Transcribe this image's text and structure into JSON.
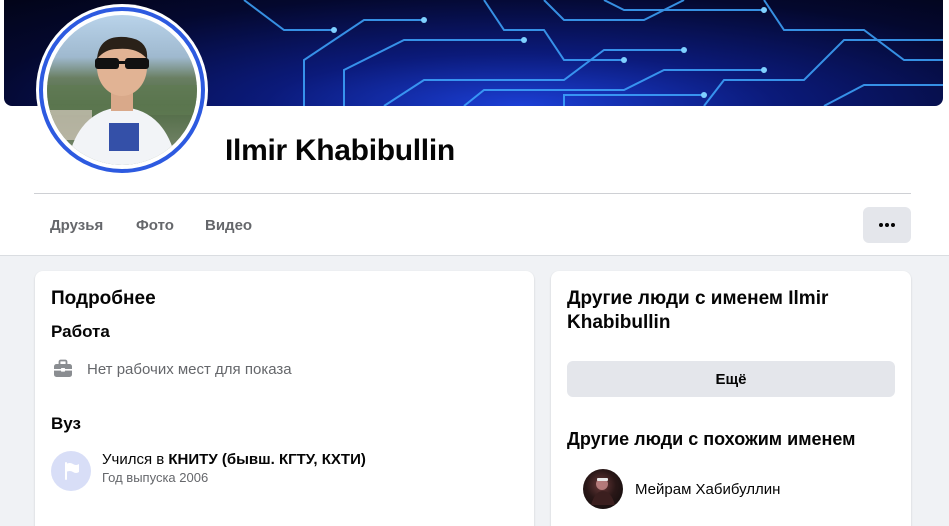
{
  "profile": {
    "name": "Ilmir Khabibullin"
  },
  "tabs": [
    {
      "label": "Друзья"
    },
    {
      "label": "Фото"
    },
    {
      "label": "Видео"
    }
  ],
  "more_menu_icon": "more-horizontal-icon",
  "about": {
    "title": "Подробнее",
    "work": {
      "heading": "Работа",
      "icon": "briefcase-icon",
      "empty_text": "Нет рабочих мест для показа"
    },
    "education": {
      "heading": "Вуз",
      "icon": "school-flag-icon",
      "prefix": "Учился в",
      "school": "КНИТУ (бывш. КГТУ, КХТИ)",
      "year": "Год выпуска 2006"
    }
  },
  "same_name": {
    "title": "Другие люди с именем Ilmir Khabibullin",
    "more_button": "Ещё"
  },
  "similar_name": {
    "title": "Другие люди с похожим именем",
    "people": [
      {
        "name": "Мейрам Хабибуллин"
      }
    ]
  },
  "colors": {
    "accent_ring": "#2d5ae0",
    "page_bg": "#f0f2f5",
    "secondary_text": "#65676b",
    "button_bg": "#e4e6eb"
  }
}
